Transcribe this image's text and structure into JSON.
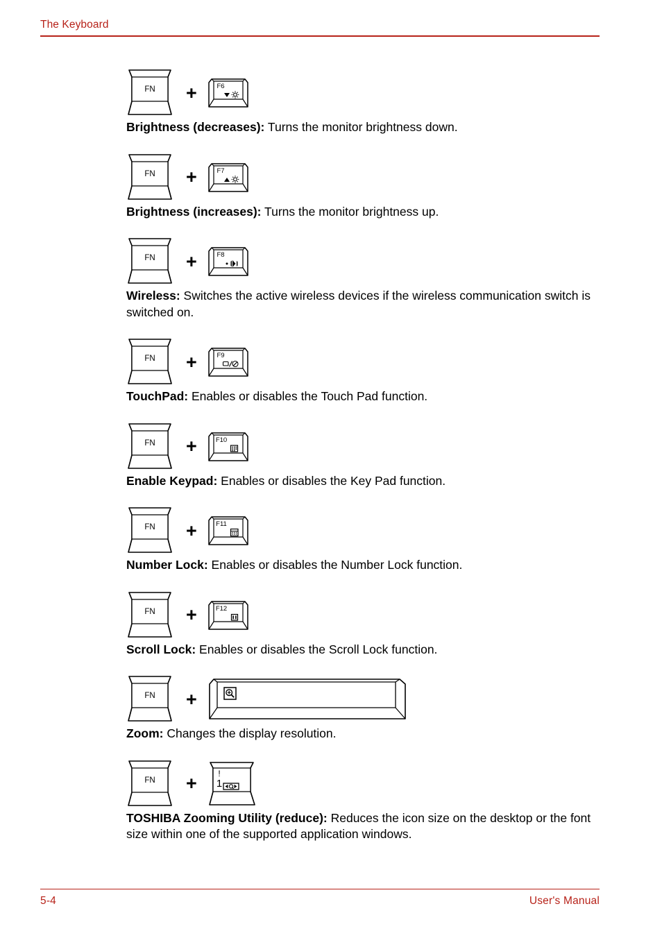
{
  "header": {
    "title": "The Keyboard",
    "accent_color": "#b72219"
  },
  "footer": {
    "page_number": "5-4",
    "doc_label": "User's Manual",
    "accent_color": "#b72219"
  },
  "labels": {
    "fn_key": "FN",
    "plus": "+"
  },
  "entries": [
    {
      "modifier": "FN",
      "key_label": "F6",
      "key_icon": "brightness-down-icon",
      "key_type": "function",
      "term": "Brightness (decreases):",
      "description": " Turns the monitor brightness down."
    },
    {
      "modifier": "FN",
      "key_label": "F7",
      "key_icon": "brightness-up-icon",
      "key_type": "function",
      "term": "Brightness (increases):",
      "description": " Turns the monitor brightness up."
    },
    {
      "modifier": "FN",
      "key_label": "F8",
      "key_icon": "wireless-icon",
      "key_type": "function",
      "term": "Wireless:",
      "description": " Switches the active wireless devices if the wireless communication switch is switched on."
    },
    {
      "modifier": "FN",
      "key_label": "F9",
      "key_icon": "touchpad-disabled-icon",
      "key_type": "function",
      "term": "TouchPad:",
      "description": " Enables or disables the Touch Pad function."
    },
    {
      "modifier": "FN",
      "key_label": "F10",
      "key_icon": "keypad-icon",
      "key_type": "function",
      "term": "Enable Keypad:",
      "description": " Enables or disables the Key Pad function."
    },
    {
      "modifier": "FN",
      "key_label": "F11",
      "key_icon": "number-lock-icon",
      "key_type": "function",
      "term": "Number Lock:",
      "description": " Enables or disables the Number Lock function."
    },
    {
      "modifier": "FN",
      "key_label": "F12",
      "key_icon": "scroll-lock-icon",
      "key_type": "function",
      "term": "Scroll Lock:",
      "description": " Enables or disables the Scroll Lock function."
    },
    {
      "modifier": "FN",
      "key_label": "",
      "key_icon": "zoom-in-magnifier-icon",
      "key_type": "spacebar",
      "term": "Zoom:",
      "description": " Changes the display resolution."
    },
    {
      "modifier": "FN",
      "key_label": "1",
      "key_shift_label": "!",
      "key_icon": "zoom-reduce-icon",
      "key_type": "number",
      "term": "TOSHIBA Zooming Utility (reduce):",
      "description": " Reduces the icon size on the desktop or the font size within one of the supported application windows."
    }
  ]
}
